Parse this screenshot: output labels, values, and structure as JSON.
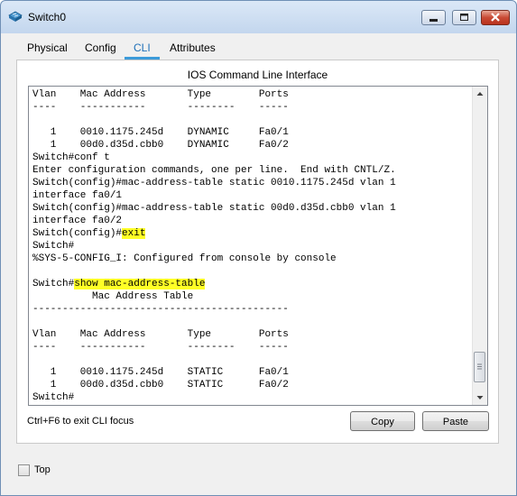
{
  "window": {
    "title": "Switch0",
    "icon": "switch-icon",
    "controls": [
      "minimize-icon",
      "maximize-icon",
      "close-icon"
    ],
    "colors": {
      "close_button": "#c94a35",
      "title_gradient": "#dbe8f7"
    }
  },
  "tabs": [
    {
      "label": "Physical",
      "active": false
    },
    {
      "label": "Config",
      "active": false
    },
    {
      "label": "CLI",
      "active": true
    },
    {
      "label": "Attributes",
      "active": false
    }
  ],
  "cli": {
    "title": "IOS Command Line Interface",
    "lines": [
      {
        "text": "Vlan    Mac Address       Type        Ports"
      },
      {
        "text": "----    -----------       --------    -----"
      },
      {
        "text": ""
      },
      {
        "text": "   1    0010.1175.245d    DYNAMIC     Fa0/1"
      },
      {
        "text": "   1    00d0.d35d.cbb0    DYNAMIC     Fa0/2"
      },
      {
        "text": "Switch#conf t"
      },
      {
        "text": "Enter configuration commands, one per line.  End with CNTL/Z."
      },
      {
        "text": "Switch(config)#mac-address-table static 0010.1175.245d vlan 1"
      },
      {
        "text": "interface fa0/1"
      },
      {
        "text": "Switch(config)#mac-address-table static 00d0.d35d.cbb0 vlan 1"
      },
      {
        "text": "interface fa0/2"
      },
      {
        "prefix": "Switch(config)#",
        "highlight": "exit"
      },
      {
        "text": "Switch#"
      },
      {
        "text": "%SYS-5-CONFIG_I: Configured from console by console"
      },
      {
        "text": ""
      },
      {
        "prefix": "Switch#",
        "highlight": "show mac-address-table"
      },
      {
        "text": "          Mac Address Table"
      },
      {
        "text": "-------------------------------------------"
      },
      {
        "text": ""
      },
      {
        "text": "Vlan    Mac Address       Type        Ports"
      },
      {
        "text": "----    -----------       --------    -----"
      },
      {
        "text": ""
      },
      {
        "text": "   1    0010.1175.245d    STATIC      Fa0/1"
      },
      {
        "text": "   1    00d0.d35d.cbb0    STATIC      Fa0/2"
      },
      {
        "text": "Switch#"
      }
    ],
    "highlight_color": "#ffff26",
    "scrollbar": {
      "position": 0.97
    }
  },
  "footer": {
    "hint": "Ctrl+F6 to exit CLI focus",
    "copy_label": "Copy",
    "paste_label": "Paste"
  },
  "top_checkbox": {
    "label": "Top",
    "checked": false
  }
}
